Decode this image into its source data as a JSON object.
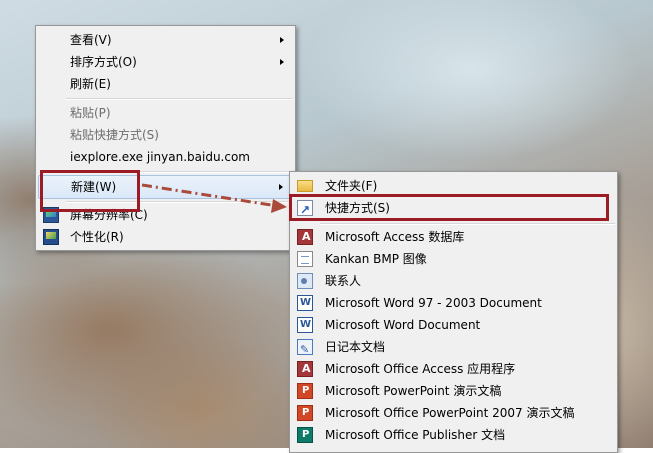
{
  "context_menu": {
    "items": [
      {
        "label": "查看(V)"
      },
      {
        "label": "排序方式(O)"
      },
      {
        "label": "刷新(E)"
      },
      {
        "label": "粘贴(P)"
      },
      {
        "label": "粘贴快捷方式(S)"
      },
      {
        "label": "iexplore.exe jinyan.baidu.com"
      },
      {
        "label": "新建(W)"
      },
      {
        "label": "屏幕分辨率(C)"
      },
      {
        "label": "个性化(R)"
      }
    ]
  },
  "new_submenu": {
    "items": [
      {
        "label": "文件夹(F)",
        "icon": "folder-icon"
      },
      {
        "label": "快捷方式(S)",
        "icon": "shortcut-icon"
      },
      {
        "label": "Microsoft Access 数据库",
        "icon": "access-icon"
      },
      {
        "label": "Kankan BMP 图像",
        "icon": "bitmap-icon"
      },
      {
        "label": "联系人",
        "icon": "contact-icon"
      },
      {
        "label": "Microsoft Word 97 - 2003 Document",
        "icon": "word-icon"
      },
      {
        "label": "Microsoft Word Document",
        "icon": "word-icon"
      },
      {
        "label": "日记本文档",
        "icon": "journal-icon"
      },
      {
        "label": "Microsoft Office Access 应用程序",
        "icon": "access-app-icon"
      },
      {
        "label": "Microsoft PowerPoint 演示文稿",
        "icon": "powerpoint-icon"
      },
      {
        "label": "Microsoft Office PowerPoint 2007 演示文稿",
        "icon": "powerpoint-icon"
      },
      {
        "label": "Microsoft Office Publisher 文档",
        "icon": "publisher-icon"
      }
    ]
  },
  "annotation": {
    "color": "#9b1c24",
    "arrow_color": "#a94a3a"
  }
}
